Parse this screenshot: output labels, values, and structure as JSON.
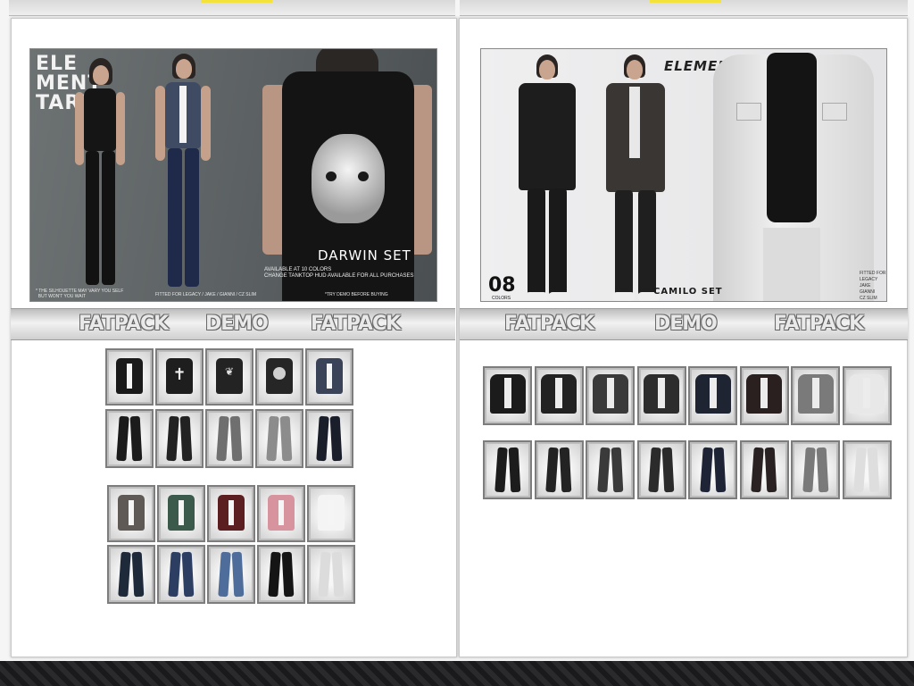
{
  "left_panel": {
    "brand_lines": "ELE\nMENT\nTARE",
    "set_title": "DARWIN SET",
    "caption": "AVAILABLE AT 10 COLORS\nCHANGE TANKTOP HUD AVAILABLE FOR ALL PURCHASES",
    "footnote_left": "* THE SILHOUETTE MAY VARY YOU SELF\n  BUT WON'T YOU WAIT",
    "footnote_mid": "FITTED FOR LEGACY / JAKE / GIANNI / CZ SLIM",
    "footnote_right": "*TRY DEMO BEFORE BUYING",
    "banner": {
      "fatpack_left": "FATPACK",
      "demo": "DEMO",
      "fatpack_right": "FATPACK"
    },
    "vest_colors_a": [
      "#1a1a1a",
      "#1e1e1e",
      "#232323",
      "#262626",
      "#3b4358"
    ],
    "pants_colors_a": [
      "#1b1b1b",
      "#222222",
      "#6f6f6f",
      "#8c8c8c",
      "#1a1e2b"
    ],
    "vest_colors_b": [
      "#5f5a55",
      "#3c5a4c",
      "#5b1f22",
      "#d7949f",
      "#f4f4f4"
    ],
    "pants_colors_b": [
      "#1e2a3a",
      "#2c3f63",
      "#4f6d9a",
      "#151515",
      "#dcdcdc"
    ]
  },
  "right_panel": {
    "brand": "ELEMENTTARE",
    "set_title": "CAMILO SET",
    "count": "08",
    "count_label": "COLORS",
    "fitted_for": "FITTED FOR\nLEGACY\nJAKE\nGIANNI\nCZ SLIM",
    "banner": {
      "fatpack_left": "FATPACK",
      "demo": "DEMO",
      "fatpack_right": "FATPACK"
    },
    "jacket_colors": [
      "#1b1b1b",
      "#222222",
      "#3a3a3a",
      "#2d2d2d",
      "#1f2433",
      "#2a2020",
      "#7a7a7a",
      "#e8e8e8"
    ],
    "pants_colors": [
      "#1c1c1c",
      "#232323",
      "#3a3a3a",
      "#2b2b2b",
      "#1e2436",
      "#2a2222",
      "#7a7a7a",
      "#dedede"
    ]
  }
}
